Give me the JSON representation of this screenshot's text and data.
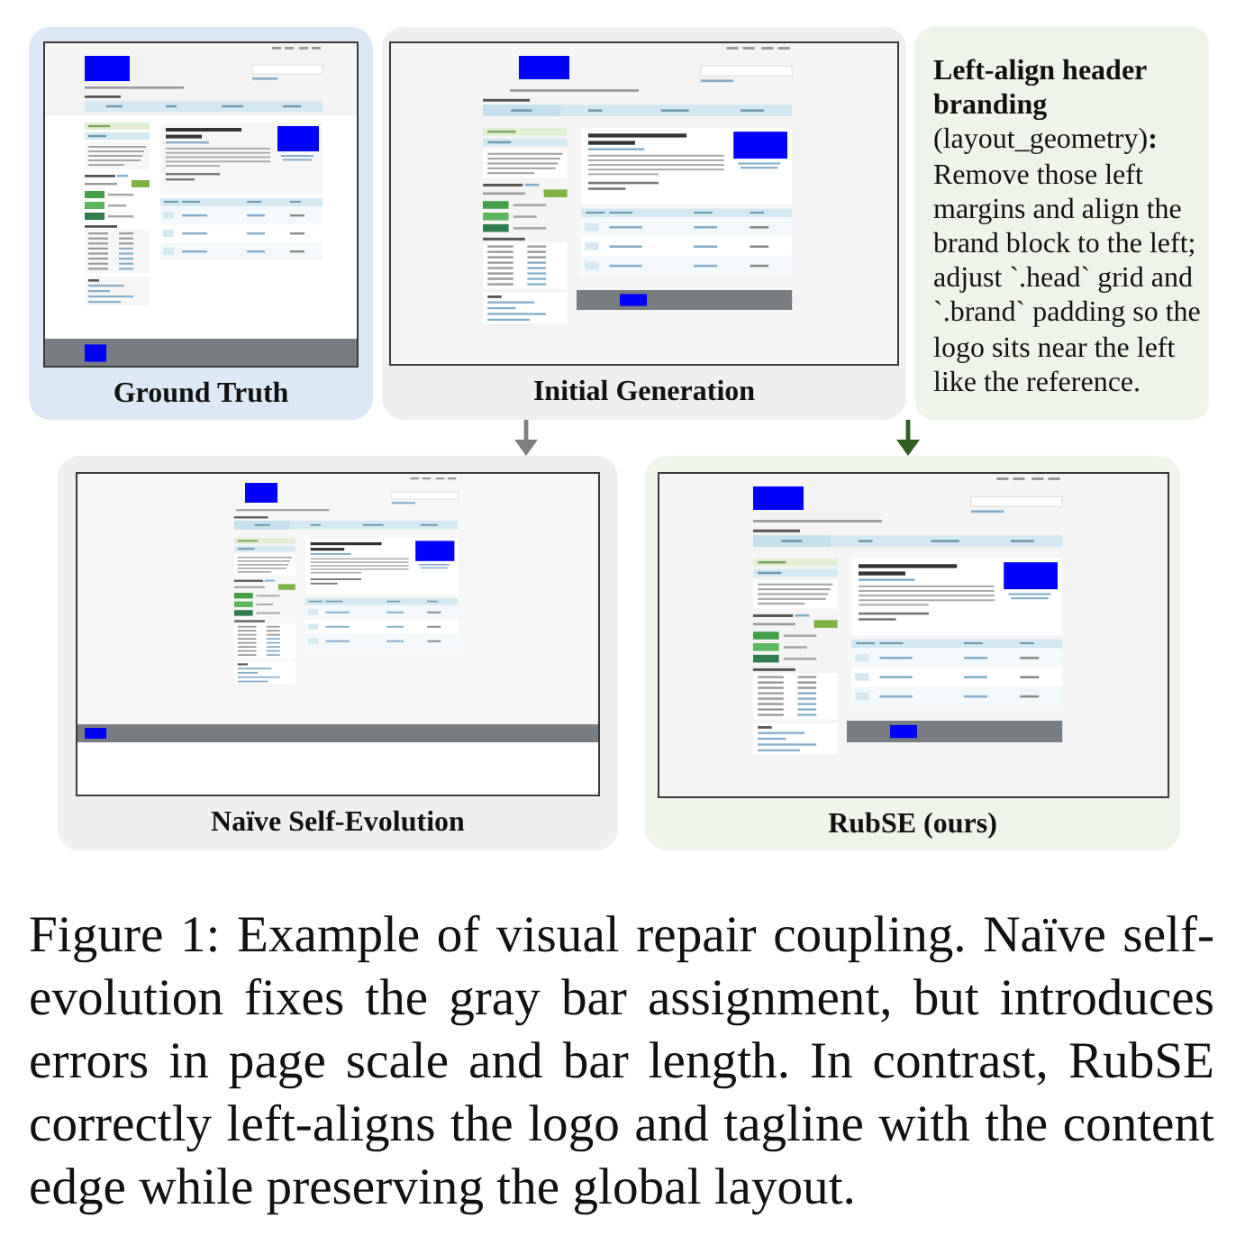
{
  "top_row": {
    "panels": [
      {
        "kind": "reference",
        "label": "Ground Truth"
      },
      {
        "kind": "initial",
        "label": "Initial Generation"
      }
    ],
    "note": {
      "text": "**Left-align header branding** (layout_geometry)**:** Remove those left margins and align the brand block to the left; adjust `.head` grid and `.brand` padding so the logo sits near the left like the reference."
    }
  },
  "bottom_row": {
    "panels": [
      {
        "kind": "naive",
        "label": "Naïve Self-Evolution"
      },
      {
        "kind": "repaired",
        "label": "RubSE (ours)"
      }
    ]
  },
  "caption": "Figure 1: Example of visual repair coupling. Naïve self-evolution fixes the gray bar assignment, but introduces errors in page scale and bar length. In contrast, RubSE correctly left-aligns the logo and tagline with the content edge while preserving the global layout."
}
